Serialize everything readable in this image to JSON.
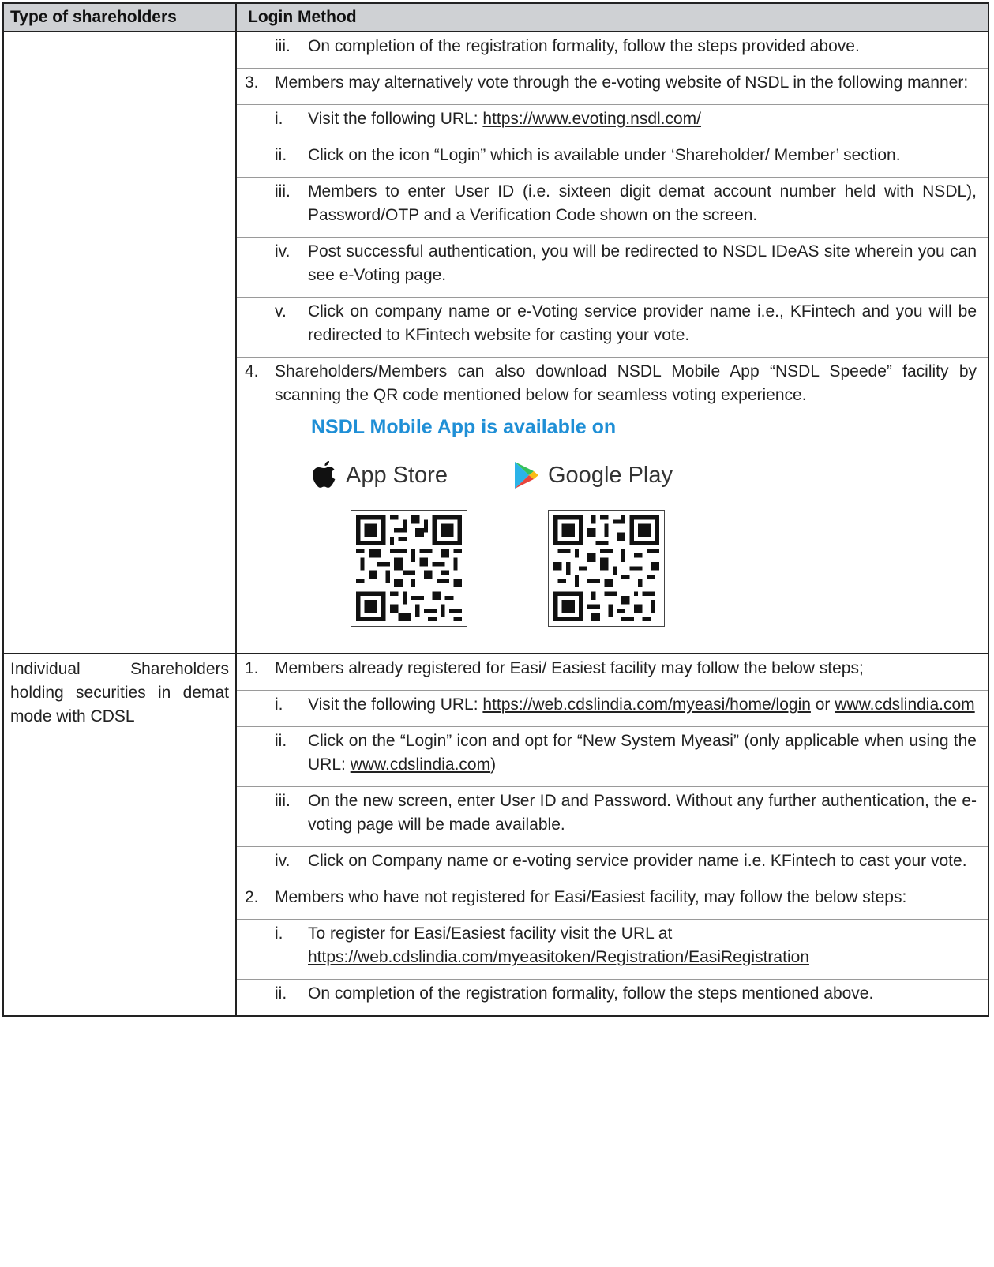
{
  "header": {
    "col1": "Type of shareholders",
    "col2": "Login Method"
  },
  "nsdl_section": {
    "item_iii": {
      "num": "iii.",
      "text": "On completion of the registration formality, follow the steps provided above."
    },
    "item3": {
      "num": "3.",
      "text": "Members may alternatively vote through the e-voting website of NSDL in the following manner:",
      "subs": [
        {
          "num": "i.",
          "pre": "Visit the following URL: ",
          "link": "https://www.evoting.nsdl.com/"
        },
        {
          "num": "ii.",
          "text": "Click on the icon “Login” which is available under ‘Shareholder/ Member’ section."
        },
        {
          "num": "iii.",
          "text": "Members to enter User ID (i.e. sixteen digit demat account number held with NSDL), Password/OTP and a Verification Code shown on the screen."
        },
        {
          "num": "iv.",
          "text": "Post successful authentication, you will be redirected to NSDL IDeAS site wherein you can see e-Voting page."
        },
        {
          "num": "v.",
          "text": "Click on company name or e-Voting service provider name i.e., KFintech and you will be redirected to KFintech website for casting your vote."
        }
      ]
    },
    "item4": {
      "num": "4.",
      "text": "Shareholders/Members can also download NSDL Mobile App “NSDL Speede” facility by scanning the QR code mentioned below for seamless voting experience."
    },
    "app": {
      "title": "NSDL Mobile App is available on",
      "app_store": "App Store",
      "google_play": "Google Play",
      "title_color": "#1f8fd6"
    }
  },
  "cdsl_section": {
    "type": "Individual Shareholders holding securities in demat mode with CDSL",
    "item1": {
      "num": "1.",
      "text": "Members already registered for Easi/ Easiest facility may follow the below steps;",
      "subs": [
        {
          "num": "i.",
          "pre": "Visit the following URL: ",
          "link": "https://web.cdslindia.com/myeasi/home/login",
          "mid": " or ",
          "link2": "www.cdslindia.com"
        },
        {
          "num": "ii.",
          "pre": "Click on the “Login” icon and opt for “New System Myeasi” (only applicable when using the URL: ",
          "link": "www.cdslindia.com",
          "post": ")"
        },
        {
          "num": "iii.",
          "text": "On the new screen, enter User ID and Password. Without any further authentication, the e-voting page will be made available."
        },
        {
          "num": "iv.",
          "text": "Click on Company name or e-voting service provider name i.e. KFintech to cast your vote."
        }
      ]
    },
    "item2": {
      "num": "2.",
      "text": "Members who have not registered for Easi/Easiest facility, may follow the below steps:",
      "subs": [
        {
          "num": "i.",
          "pre": "To register for Easi/Easiest facility visit the URL at",
          "link": "https://web.cdslindia.com/myeasitoken/Registration/EasiRegistration"
        },
        {
          "num": "ii.",
          "text": "On completion of the registration formality, follow the steps mentioned above."
        }
      ]
    }
  }
}
